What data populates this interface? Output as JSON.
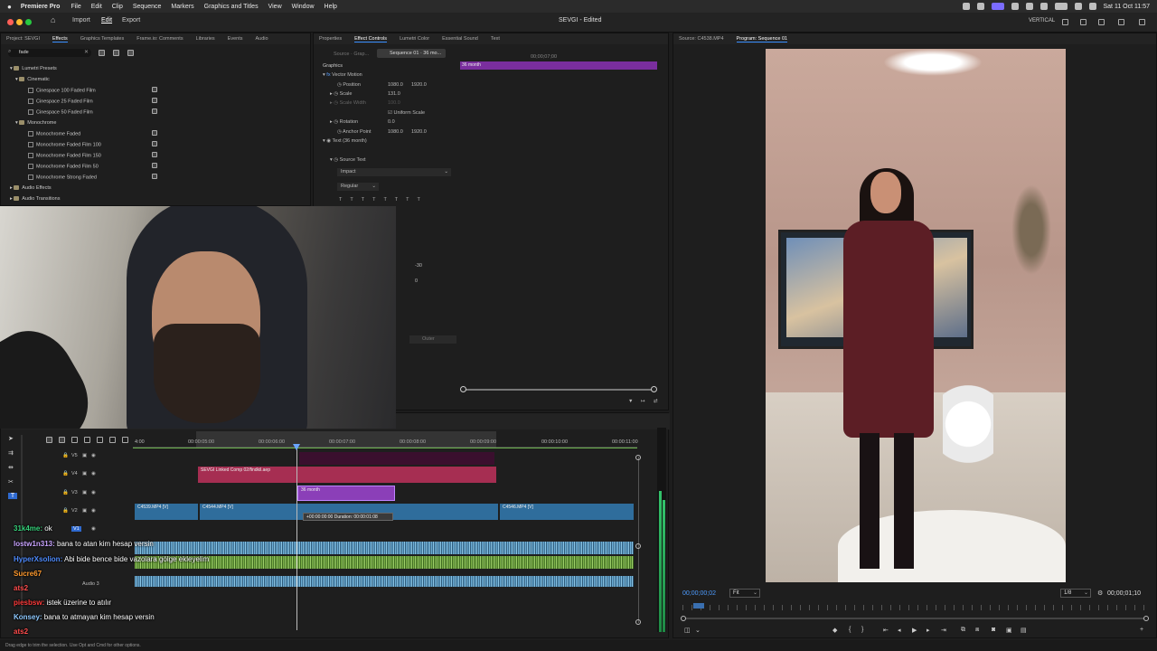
{
  "menubar": {
    "app_name": "Premiere Pro",
    "items": [
      "File",
      "Edit",
      "Clip",
      "Sequence",
      "Markers",
      "Graphics and Titles",
      "View",
      "Window",
      "Help"
    ],
    "clock": "Sat 11 Oct 11:57"
  },
  "titlebar": {
    "home": "⌂",
    "workspaces": [
      "Import",
      "Edit",
      "Export"
    ],
    "title": "SEVGI - Edited",
    "vertical_label": "VERTICAL"
  },
  "project_panel": {
    "tabs": [
      "Project: SEVGI",
      "Effects",
      "Graphics Templates",
      "Frame.io: Comments",
      "Libraries",
      "Events",
      "Audio"
    ],
    "active_tab": "Effects",
    "search_value": "fade",
    "tree": [
      {
        "label": "Lumetri Presets",
        "type": "folder"
      },
      {
        "label": "Cinematic",
        "type": "folder"
      },
      {
        "label": "Cinespace 100 Faded Film",
        "type": "effect"
      },
      {
        "label": "Cinespace 25 Faded Film",
        "type": "effect"
      },
      {
        "label": "Cinespace 50 Faded Film",
        "type": "effect"
      },
      {
        "label": "Monochrome",
        "type": "folder"
      },
      {
        "label": "Monochrome Faded",
        "type": "effect"
      },
      {
        "label": "Monochrome Faded Film 100",
        "type": "effect"
      },
      {
        "label": "Monochrome Faded Film 150",
        "type": "effect"
      },
      {
        "label": "Monochrome Faded Film 50",
        "type": "effect"
      },
      {
        "label": "Monochrome Strong Faded",
        "type": "effect"
      },
      {
        "label": "Audio Effects",
        "type": "folder"
      },
      {
        "label": "Audio Transitions",
        "type": "folder"
      }
    ]
  },
  "effect_controls": {
    "tabs": [
      "Properties",
      "Effect Controls",
      "Lumetri Color",
      "Essential Sound",
      "Text"
    ],
    "active_tab": "Effect Controls",
    "source_dropdown": "Source · Grap...",
    "sequence_dropdown": "Sequence 01 · 36 mo...",
    "timecode": "00;00;07;00",
    "clip_label": "36 month",
    "section": "Graphics",
    "vector_motion": "Vector Motion",
    "position_label": "Position",
    "position_x": "1080.0",
    "position_y": "1920.0",
    "scale_label": "Scale",
    "scale_value": "131.0",
    "scale_width_label": "Scale Width",
    "scale_width_value": "100.0",
    "uniform_scale": "Uniform Scale",
    "rotation_label": "Rotation",
    "rotation_value": "0.0",
    "anchor_label": "Anchor Point",
    "anchor_x": "1080.0",
    "anchor_y": "1920.0",
    "text_layer": "Text (36 month)",
    "source_text": "Source Text",
    "font": "Impact",
    "font_style": "Regular",
    "tracking_value": "-30",
    "leading_value": "0",
    "stroke_style": "Outer"
  },
  "source_monitor": {
    "tabs": [
      "Source: C4538.MP4",
      "Program: Sequence 01"
    ],
    "active_tab": "Program: Sequence 01"
  },
  "program_monitor": {
    "timecode_in": "00;00;00;02",
    "fit": "Fit",
    "resolution": "1/8",
    "duration": "00;00;01;10"
  },
  "timeline": {
    "ruler_labels": [
      "4:00",
      "00:00:05:00",
      "00:00:06:00",
      "00:00:07:00",
      "00:00:08:00",
      "00:00:09:00",
      "00:00:10:00",
      "00:00:11:00"
    ],
    "tracks": [
      "V5",
      "V4",
      "V3",
      "V2",
      "V1"
    ],
    "audio_track": "Audio 3",
    "clips": {
      "linked_comp": "SEVGI Linked Comp 02/findkil.aep",
      "graphic": "36 month",
      "c4539": "C4539.MP4 [V]",
      "c4544": "C4544.MP4 [V]",
      "c4546": "C4546.MP4 [V]"
    },
    "duration_tooltip": "+00:00:00:00  Duration: 00:00:01:08"
  },
  "chat": [
    {
      "user": "31k4me:",
      "msg": "ok",
      "color": "#36d17a"
    },
    {
      "user": "lostw1n313:",
      "msg": "bana to atan kim hesap versin",
      "color": "#c9a4ff"
    },
    {
      "user": "HyperXsolion:",
      "msg": "Abi bide bence bide vazolara gölge ekleyelim",
      "color": "#4f8cff"
    },
    {
      "user": "Sucre67",
      "msg": "",
      "color": "#ff9a2e"
    },
    {
      "user": "ats2",
      "msg": "",
      "color": "#ff4d4d"
    },
    {
      "user": "piesbsw:",
      "msg": "istek üzerine to atılır",
      "color": "#ff3b3b"
    },
    {
      "user": "Konsey:",
      "msg": "bana to atmayan kim hesap versin",
      "color": "#8ec9ff"
    },
    {
      "user": "ats2",
      "msg": "",
      "color": "#ff4d4d"
    }
  ],
  "status_bar": "Drag edge to trim the selection. Use Opt and Cmd for other options.",
  "colors": {
    "accent": "#3a8fff",
    "graphic_clip": "#8b3fb8",
    "comp_clip": "#b8365a",
    "video_clip": "#2f6d9c",
    "audio_green": "#5e9a36"
  }
}
